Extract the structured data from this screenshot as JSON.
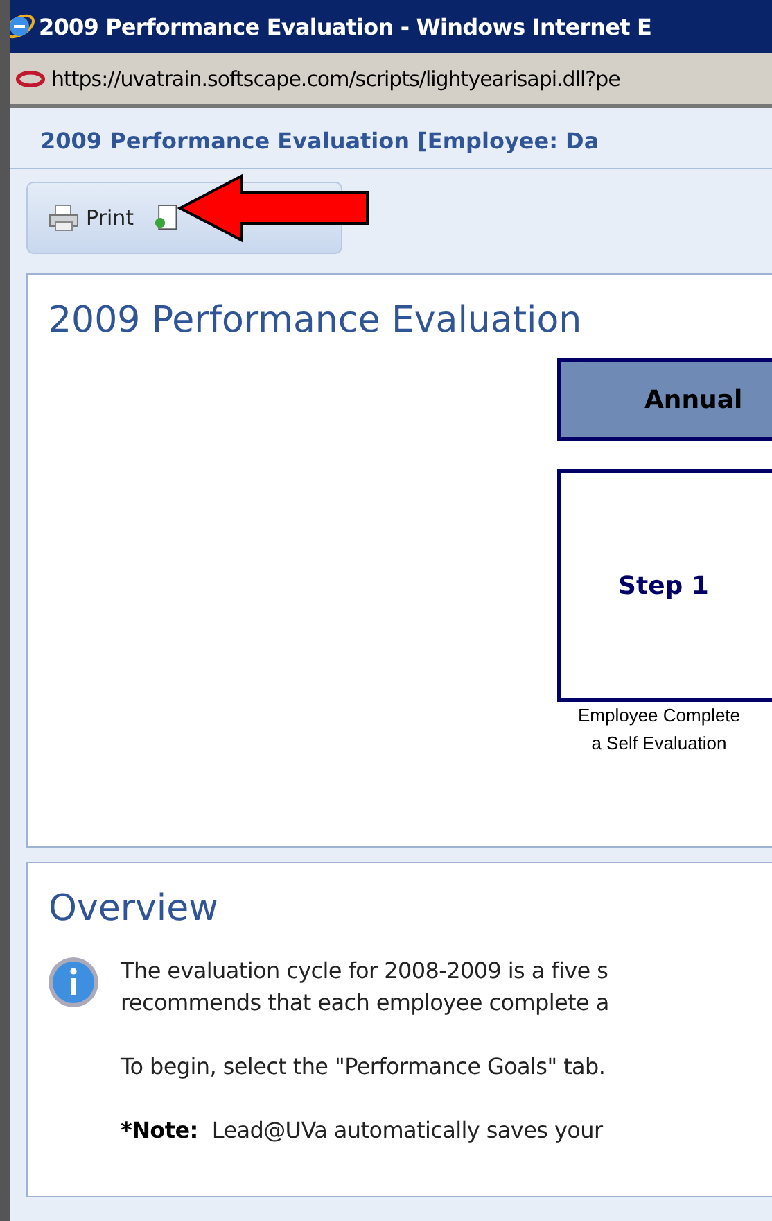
{
  "window": {
    "title": "2009 Performance Evaluation - Windows Internet E"
  },
  "address_bar": {
    "url": "https://uvatrain.softscape.com/scripts/lightyearisapi.dll?pe"
  },
  "page_header": "2009 Performance Evaluation [Employee: Da",
  "toolbar": {
    "buttons": [
      {
        "kind": "print",
        "label": "Print"
      },
      {
        "kind": "export"
      }
    ]
  },
  "annotation": {
    "kind": "arrow"
  },
  "evaluation": {
    "title": "2009 Performance Evaluation",
    "process_header": "Annual",
    "steps": [
      {
        "label": "Step 1",
        "caption_lines": [
          "Employee Complete",
          "a Self Evaluation"
        ]
      }
    ]
  },
  "overview": {
    "title": "Overview",
    "paragraph_lines": [
      "The evaluation cycle for 2008-2009 is a five s",
      "recommends that each employee complete a"
    ],
    "instruction": "To begin, select the \"Performance Goals\" tab.",
    "note_label": "*Note:",
    "note_text": "Lead@UVa automatically saves your"
  }
}
